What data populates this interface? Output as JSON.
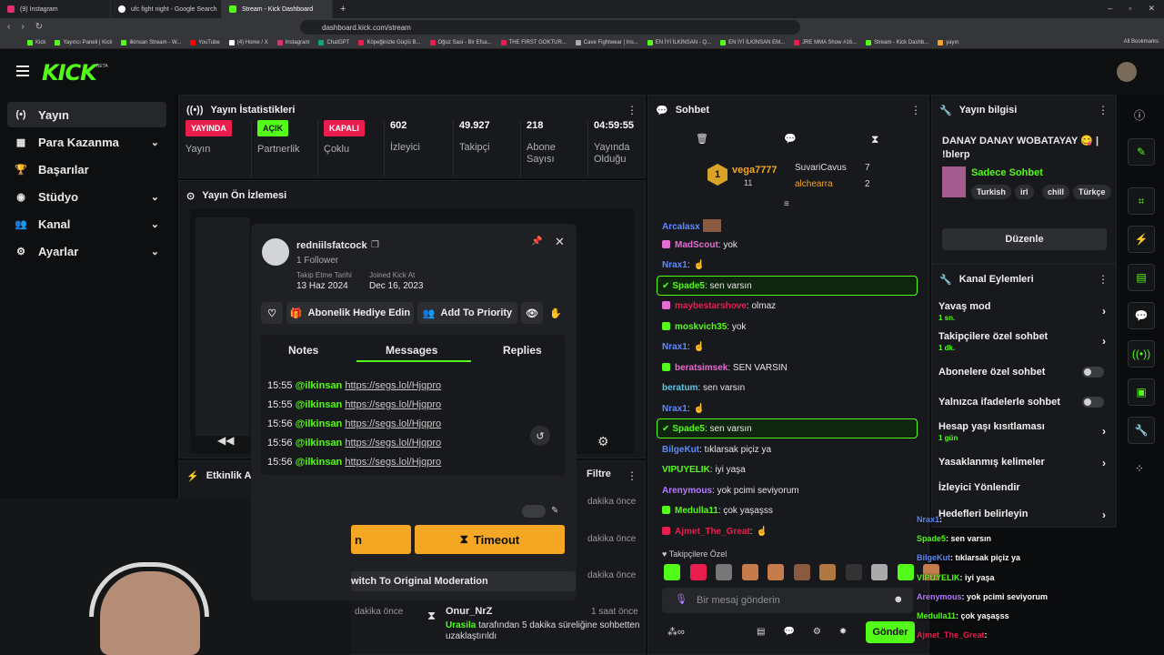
{
  "browser": {
    "tabs": [
      {
        "label": "(9) Instagram",
        "color": "#e1306c"
      },
      {
        "label": "ufc fight night - Google Search",
        "color": "#ffffff"
      },
      {
        "label": "Stream - Kick Dashboard",
        "color": "#53fc18"
      }
    ],
    "new_tab": "+",
    "url": "dashboard.kick.com/stream",
    "bookmarks": [
      "Kick",
      "Yayıncı Paneli | Kick",
      "ilkinsan Stream - W...",
      "YouTube",
      "(4) Home / X",
      "Instagram",
      "ChatGPT",
      "Köpeğinizle Güçlü B...",
      "Oğuz Sasi - Bir Efsa...",
      "THE FIRST GOKTUR...",
      "Cave Fightwear | Ins...",
      "EN İYİ İLKİNSAN - Q...",
      "EN İYİ İLKİNSAN EM...",
      "JRE MMA Show #16...",
      "Stream - Kick Dashb...",
      "yayın"
    ],
    "all_bookmarks": "All Bookmarks"
  },
  "logo": "KICK",
  "logo_badge": "BETA",
  "sidebar": [
    {
      "label": "Yayın",
      "icon": "broadcast-icon",
      "active": true
    },
    {
      "label": "Para Kazanma",
      "icon": "money-icon",
      "chev": true
    },
    {
      "label": "Başarılar",
      "icon": "trophy-icon"
    },
    {
      "label": "Stüdyo",
      "icon": "studio-icon",
      "chev": true
    },
    {
      "label": "Kanal",
      "icon": "users-icon",
      "chev": true
    },
    {
      "label": "Ayarlar",
      "icon": "gear-icon",
      "chev": true
    }
  ],
  "stats": {
    "title": "Yayın İstatistikleri",
    "items": [
      {
        "value": "YAYINDA",
        "label": "Yayın",
        "color": "#e91e4f"
      },
      {
        "value": "AÇIK",
        "label": "Partnerlik",
        "color": "#53fc18"
      },
      {
        "value": "KAPALI",
        "label": "Çoklu",
        "color": "#e91e4f"
      },
      {
        "value": "602",
        "label": "İzleyici"
      },
      {
        "value": "49.927",
        "label": "Takipçi"
      },
      {
        "value": "218",
        "label": "Abone Sayısı"
      },
      {
        "value": "04:59:55",
        "label": "Yayında Olduğu"
      }
    ]
  },
  "preview": {
    "title": "Yayın Ön İzlemesi"
  },
  "activity": {
    "title": "Etkinlik A",
    "filter": "Filtre"
  },
  "popup": {
    "username": "redniilsfatcock",
    "followers": "1 Follower",
    "follow_date_label": "Takip Etme Tarihi",
    "follow_date": "13 Haz 2024",
    "joined_label": "Joined Kick At",
    "joined": "Dec 16, 2023",
    "gift_btn": "Abonelik Hediye Edin",
    "priority_btn": "Add To Priority",
    "tabs": [
      "Notes",
      "Messages",
      "Replies"
    ],
    "messages": [
      {
        "time": "15:55",
        "user": "@ilkinsan",
        "link": "https://segs.lol/Hjqpro"
      },
      {
        "time": "15:55",
        "user": "@ilkinsan",
        "link": "https://segs.lol/Hjqpro"
      },
      {
        "time": "15:56",
        "user": "@ilkinsan",
        "link": "https://segs.lol/Hjqpro"
      },
      {
        "time": "15:56",
        "user": "@ilkinsan",
        "link": "https://segs.lol/Hjqpro"
      },
      {
        "time": "15:56",
        "user": "@ilkinsan",
        "link": "https://segs.lol/Hjqpro"
      }
    ],
    "ban_btn": "n",
    "timeout_btn": "Timeout",
    "switch_btn": "witch To Original Moderation"
  },
  "activity_items": [
    {
      "time": "dakika önce"
    },
    {
      "time": "dakika önce"
    },
    {
      "time": "dakika önce"
    },
    {
      "time": "dakika önce",
      "user": "Onur_NrZ",
      "ago": "1 saat önce",
      "text1": "Urasila",
      "text2": "tarafından 5 dakika süreliğine sohbetten",
      "text3": "uzaklaştırıldı"
    }
  ],
  "chat": {
    "title": "Sohbet",
    "leaders": [
      {
        "name": "vega7777",
        "count": "11"
      },
      {
        "name": "SuvariCavus",
        "count": "7"
      },
      {
        "name": "alchearra",
        "count": "2"
      }
    ],
    "rank": "1",
    "lines": [
      {
        "user": "Arcalasx",
        "color": "#5b8bff",
        "text": ""
      },
      {
        "user": "MadScout",
        "color": "#e76bd4",
        "text": ": yok"
      },
      {
        "user": "Nrax1",
        "color": "#5b8bff",
        "text": ":"
      },
      {
        "user": "Spade5",
        "color": "#53fc18",
        "text": ": sen varsın",
        "hl": true
      },
      {
        "user": "maybestarshove",
        "color": "#e91e4f",
        "text": ": olmaz"
      },
      {
        "user": "moskvich35",
        "color": "#53fc18",
        "text": ": yok"
      },
      {
        "user": "Nrax1",
        "color": "#5b8bff",
        "text": ":"
      },
      {
        "user": "beratsimsek",
        "color": "#e76bd4",
        "text": ": SEN VARSIN"
      },
      {
        "user": "beratum",
        "color": "#5ac8e6",
        "text": ": sen varsın"
      },
      {
        "user": "Nrax1",
        "color": "#5b8bff",
        "text": ":"
      },
      {
        "user": "Spade5",
        "color": "#53fc18",
        "text": ": sen varsın",
        "hl": true
      },
      {
        "user": "BilgeKut",
        "color": "#5b8bff",
        "text": ": tıklarsak piçiz ya"
      },
      {
        "user": "VIPUYELIK",
        "color": "#53fc18",
        "text": ": iyi yaşa"
      },
      {
        "user": "Arenymous",
        "color": "#b57bff",
        "text": ": yok pcimi seviyorum"
      },
      {
        "user": "Medulla11",
        "color": "#53fc18",
        "text": ": çok yaşaşss"
      },
      {
        "user": "Ajmet_The_Great",
        "color": "#e91e4f",
        "text": ":"
      }
    ],
    "followers_only": "Takipçilere Özel",
    "input_placeholder": "Bir mesaj gönderin",
    "send": "Gönder"
  },
  "info": {
    "title": "Yayın bilgisi",
    "stream_title": "DANAY DANAY WOBATAYAY 😋 | !blerp",
    "category": "Sadece Sohbet",
    "tags": [
      "Turkish",
      "irl",
      "chill",
      "Türkçe"
    ],
    "edit": "Düzenle"
  },
  "actions": {
    "title": "Kanal Eylemleri",
    "items": [
      {
        "label": "Yavaş mod",
        "sub": "1 sn.",
        "type": "chev"
      },
      {
        "label": "Takipçilere özel sohbet",
        "sub": "1 dk.",
        "type": "chev"
      },
      {
        "label": "Abonelere özel sohbet",
        "type": "toggle"
      },
      {
        "label": "Yalnızca ifadelerle sohbet",
        "type": "toggle"
      },
      {
        "label": "Hesap yaşı kısıtlaması",
        "sub": "1 gün",
        "type": "chev"
      },
      {
        "label": "Yasaklanmış kelimeler",
        "type": "chev"
      },
      {
        "label": "İzleyici Yönlendir",
        "type": "none"
      },
      {
        "label": "Hedefleri belirleyin",
        "type": "chev"
      }
    ]
  },
  "overlay_chat": [
    {
      "user": "Nrax1",
      "color": "#5b8bff",
      "text": ":"
    },
    {
      "user": "Spade5",
      "color": "#53fc18",
      "text": ": sen varsın"
    },
    {
      "user": "BilgeKut",
      "color": "#5b8bff",
      "text": ": tıklarsak piçiz ya"
    },
    {
      "user": "VIPUYELIK",
      "color": "#53fc18",
      "text": ": iyi yaşa"
    },
    {
      "user": "Arenymous",
      "color": "#b57bff",
      "text": ": yok pcimi seviyorum"
    },
    {
      "user": "Medulla11",
      "color": "#53fc18",
      "text": ": çok yaşaşss"
    },
    {
      "user": "Ajmet_The_Great",
      "color": "#e91e4f",
      "text": ":"
    }
  ],
  "colors": {
    "accent": "#53fc18",
    "live": "#e91e4f",
    "timeout": "#f5a623"
  }
}
